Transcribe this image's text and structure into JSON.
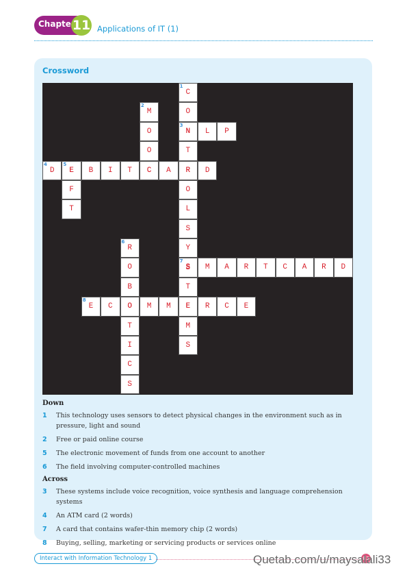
{
  "header": {
    "chapter_label": "Chapter",
    "chapter_number": "11",
    "title": "Applications of IT (1)"
  },
  "panel": {
    "title": "Crossword"
  },
  "crossword": {
    "rows": 16,
    "cols": 16,
    "words": [
      {
        "number": "1",
        "dir": "down",
        "row": 0,
        "col": 7,
        "answer": "CONTROLSYSTEMS"
      },
      {
        "number": "2",
        "dir": "down",
        "row": 1,
        "col": 5,
        "answer": "MOOC"
      },
      {
        "number": "3",
        "dir": "across",
        "row": 2,
        "col": 7,
        "answer": "NLP"
      },
      {
        "number": "4",
        "dir": "across",
        "row": 4,
        "col": 0,
        "answer": "DEBITCARD"
      },
      {
        "number": "5",
        "dir": "down",
        "row": 4,
        "col": 1,
        "answer": "EFT"
      },
      {
        "number": "6",
        "dir": "down",
        "row": 8,
        "col": 4,
        "answer": "ROBOTICS"
      },
      {
        "number": "7",
        "dir": "across",
        "row": 9,
        "col": 7,
        "answer": "SMARTCARD"
      },
      {
        "number": "8",
        "dir": "across",
        "row": 11,
        "col": 2,
        "answer": "ECOMMERCE"
      }
    ]
  },
  "clues": {
    "down_heading": "Down",
    "down": [
      {
        "number": "1",
        "text": "This technology uses sensors to detect physical changes in the environment such as in pressure, light and sound"
      },
      {
        "number": "2",
        "text": "Free or paid online course"
      },
      {
        "number": "5",
        "text": "The electronic movement of funds from one account to another"
      },
      {
        "number": "6",
        "text": "The field involving computer-controlled machines"
      }
    ],
    "across_heading": "Across",
    "across": [
      {
        "number": "3",
        "text": "These systems include voice recognition, voice synthesis and language comprehension systems"
      },
      {
        "number": "4",
        "text": "An ATM card (2 words)"
      },
      {
        "number": "7",
        "text": "A card that contains wafer-thin memory chip (2 words)"
      },
      {
        "number": "8",
        "text": "Buying, selling, marketing or servicing products or services online"
      }
    ]
  },
  "footer": {
    "book_title": "Interact with Information Technology 1",
    "watermark": "Quetab.com/u/maysalali33",
    "page_number": "83"
  },
  "colors": {
    "accent": "#1a9ad6",
    "chapter": "#9c2387",
    "chapter_num": "#9bc53d",
    "letter": "#d9232e",
    "grid": "#262223",
    "panel": "#dff1fb"
  }
}
